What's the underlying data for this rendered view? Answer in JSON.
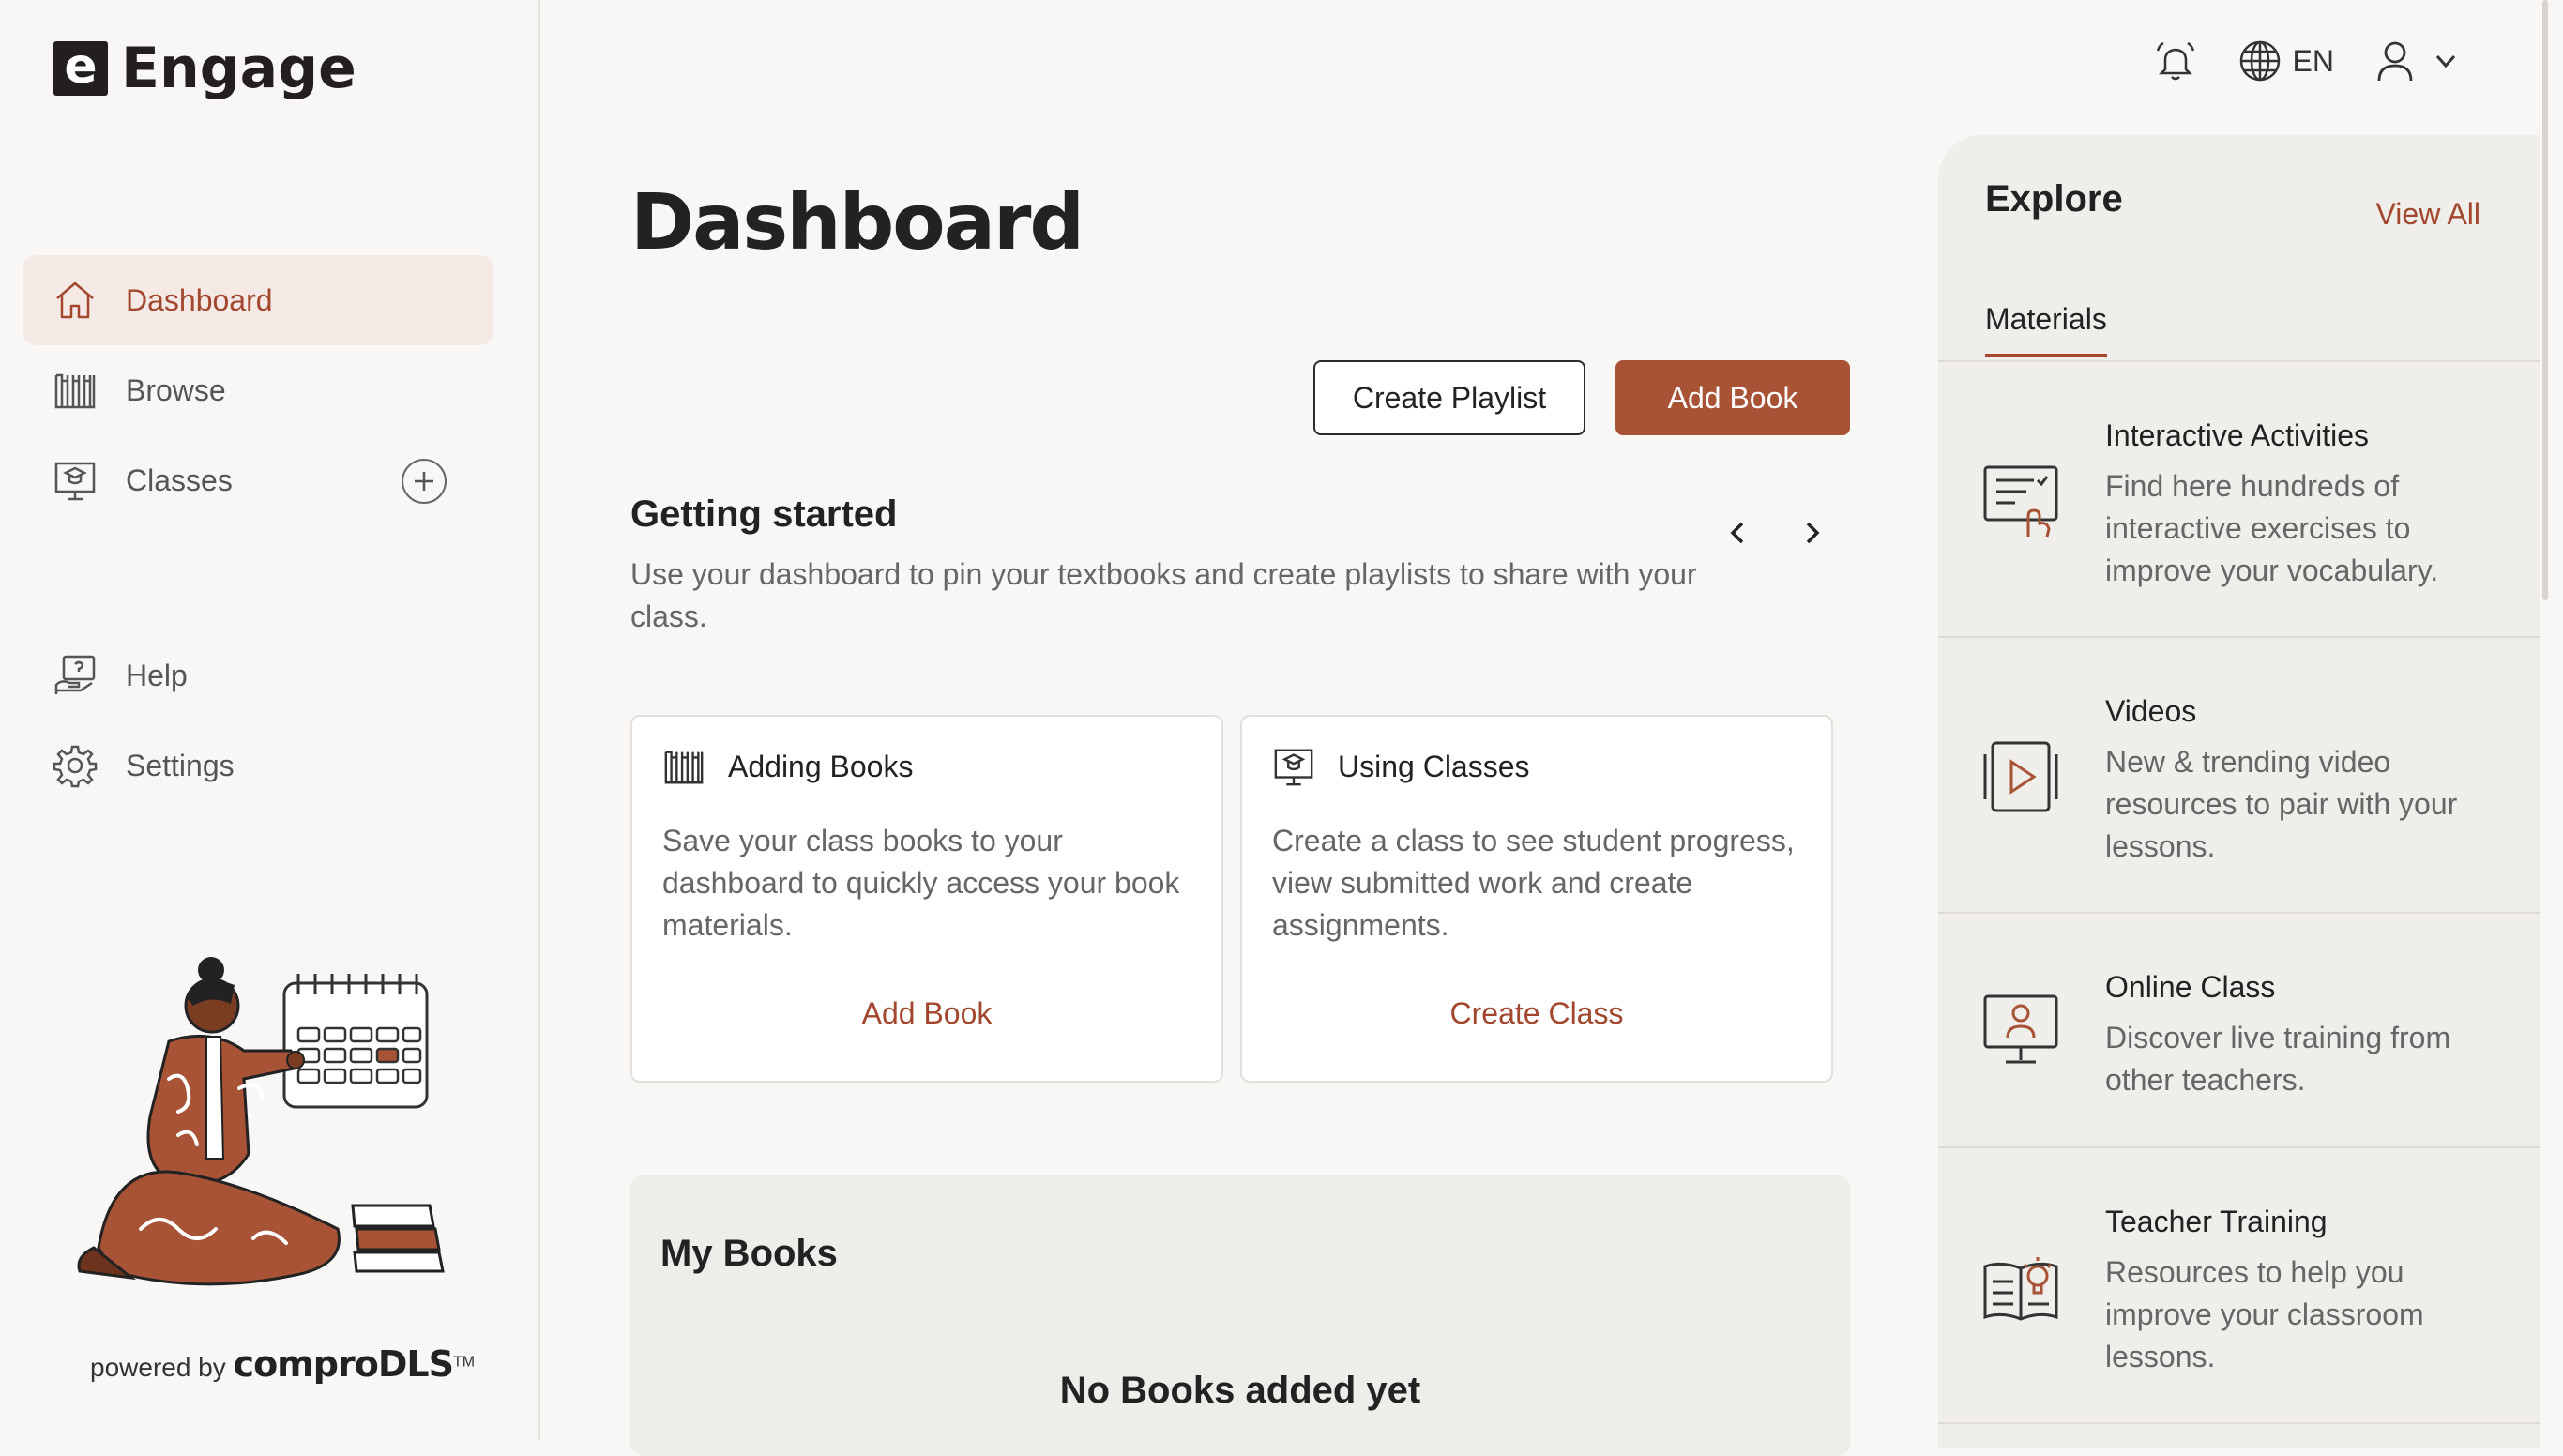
{
  "app": {
    "logo_letter": "e",
    "name": "Engage"
  },
  "sidebar": {
    "items": [
      {
        "label": "Dashboard",
        "icon": "home-icon",
        "active": true
      },
      {
        "label": "Browse",
        "icon": "books-shelf-icon"
      },
      {
        "label": "Classes",
        "icon": "classroom-icon"
      },
      {
        "label": "Help",
        "icon": "help-icon"
      },
      {
        "label": "Settings",
        "icon": "gear-icon"
      }
    ],
    "powered_prefix": "powered by",
    "powered_brand": "comproDLS",
    "powered_tm": "TM"
  },
  "topbar": {
    "language": "EN",
    "icons": [
      "bell-icon",
      "globe-icon",
      "user-icon",
      "chevron-down-icon"
    ]
  },
  "main": {
    "title": "Dashboard",
    "create_playlist": "Create Playlist",
    "add_book": "Add Book",
    "getting_started": {
      "title": "Getting started",
      "description": "Use your dashboard to pin your textbooks and create playlists to share with your class.",
      "cards": [
        {
          "title": "Adding Books",
          "body": "Save your class books to your dashboard to quickly access your book materials.",
          "link": "Add Book"
        },
        {
          "title": "Using Classes",
          "body": "Create a class to see student progress, view submitted work and create assignments.",
          "link": "Create Class"
        }
      ]
    },
    "my_books": {
      "title": "My Books",
      "empty": "No Books added yet"
    }
  },
  "explore": {
    "title": "Explore",
    "view_all": "View All",
    "tab": "Materials",
    "items": [
      {
        "title": "Interactive Activities",
        "desc": "Find here hundreds of interactive exercises to improve your vocabulary.",
        "icon": "interactive-activity-icon"
      },
      {
        "title": "Videos",
        "desc": "New & trending video resources to pair with your lessons.",
        "icon": "video-icon"
      },
      {
        "title": "Online Class",
        "desc": "Discover live training from other teachers.",
        "icon": "online-class-icon"
      },
      {
        "title": "Teacher Training",
        "desc": "Resources to help you improve your classroom lessons.",
        "icon": "teacher-training-icon"
      }
    ]
  },
  "colors": {
    "accent": "#a85336",
    "accent_text": "#a2472e",
    "active_bg": "#f5e9e5",
    "background": "#f8f7f5"
  }
}
